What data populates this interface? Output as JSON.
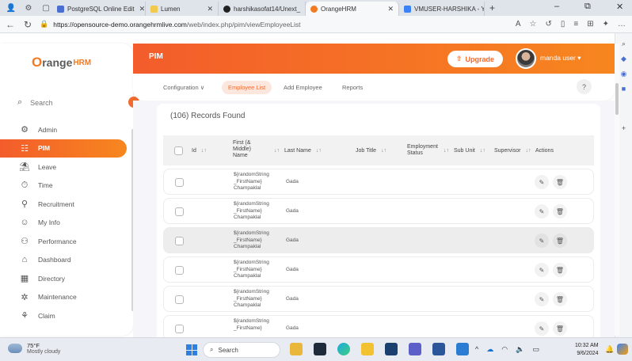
{
  "browser": {
    "tabs": [
      {
        "title": "PostgreSQL Online Edit",
        "color": "#4a6fd1"
      },
      {
        "title": "Lumen",
        "color": "#f2c94c"
      },
      {
        "title": "harshikasofat14/Unext_",
        "color": "#222222"
      },
      {
        "title": "OrangeHRM",
        "color": "#f37a21"
      },
      {
        "title": "VMUSER-HARSHIKA - Y",
        "color": "#3b82f6"
      }
    ],
    "new_tab": "+",
    "minimize": "–",
    "restore": "⧉",
    "close": "✕",
    "url_host": "https://opensource-demo.orangehrmlive.com",
    "url_path": "/web/index.php/pim/viewEmployeeList"
  },
  "app": {
    "logo_text": "range",
    "logo_suffix": "HRM",
    "logo_o": "O",
    "header_title": "PIM",
    "upgrade_label": "Upgrade",
    "user_name": "manda user ▾",
    "search_label": "Search",
    "menu": [
      {
        "label": "Admin",
        "icon": "⚙"
      },
      {
        "label": "PIM",
        "icon": "👥"
      },
      {
        "label": "Leave",
        "icon": "🗓"
      },
      {
        "label": "Time",
        "icon": "⏱"
      },
      {
        "label": "Recruitment",
        "icon": "🔍"
      },
      {
        "label": "My Info",
        "icon": "👤"
      },
      {
        "label": "Performance",
        "icon": "📈"
      },
      {
        "label": "Dashboard",
        "icon": "⌂"
      },
      {
        "label": "Directory",
        "icon": "📇"
      },
      {
        "label": "Maintenance",
        "icon": "⚙"
      },
      {
        "label": "Claim",
        "icon": "💳"
      }
    ],
    "subnav": {
      "configuration": "Configuration ∨",
      "employee_list": "Employee List",
      "add_employee": "Add Employee",
      "reports": "Reports",
      "help": "?"
    }
  },
  "table": {
    "records": "(106) Records Found",
    "headers": {
      "id": "Id",
      "first_middle_1": "First (&",
      "first_middle_2": "Middle)",
      "first_middle_3": "Name",
      "last": "Last Name",
      "job": "Job Title",
      "emp_status_1": "Employment",
      "emp_status_2": "Status",
      "sub_unit": "Sub Unit",
      "supervisor": "Supervisor",
      "actions": "Actions"
    },
    "rows": [
      {
        "first1": "${randomString",
        "first2": "_FirstName}",
        "first3": "Champaklal",
        "last": "Gada"
      },
      {
        "first1": "${randomString",
        "first2": "_FirstName}",
        "first3": "Champaklal",
        "last": "Gada"
      },
      {
        "first1": "${randomString",
        "first2": "_FirstName}",
        "first3": "Champaklal",
        "last": "Gada"
      },
      {
        "first1": "${randomString",
        "first2": "_FirstName}",
        "first3": "Champaklal",
        "last": "Gada"
      },
      {
        "first1": "${randomString",
        "first2": "_FirstName}",
        "first3": "Champaklal",
        "last": "Gada"
      },
      {
        "first1": "${randomString",
        "first2": "_FirstName}",
        "first3": "",
        "last": "Gada"
      }
    ]
  },
  "taskbar": {
    "temp": "75°F",
    "weather": "Mostly cloudy",
    "search": "Search",
    "time": "10:32 AM",
    "date": "9/6/2024"
  }
}
